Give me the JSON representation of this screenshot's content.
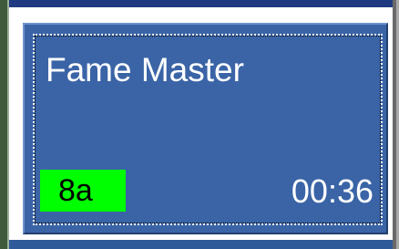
{
  "tile": {
    "title": "Fame Master",
    "level_badge": "8a",
    "time": "00:36"
  },
  "colors": {
    "tile_background": "#3a64a6",
    "badge_background": "#00ff00",
    "text": "#ffffff"
  }
}
